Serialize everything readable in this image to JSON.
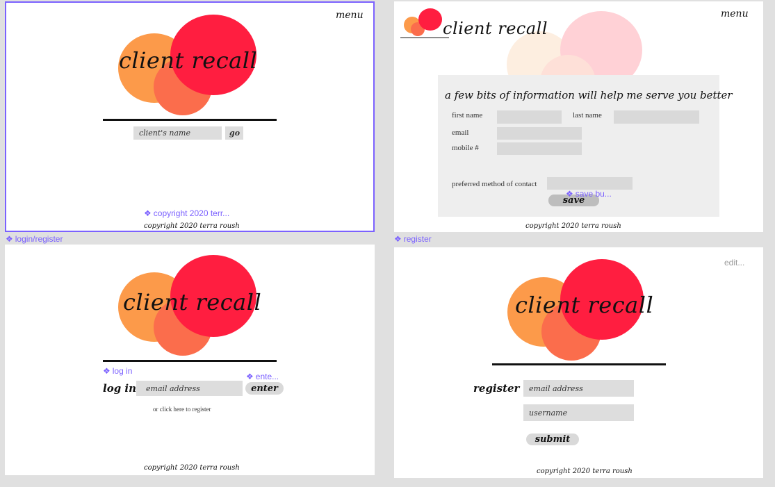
{
  "frames": {
    "home": {
      "menu": "menu",
      "logo": "client recall",
      "search_placeholder": "client's name",
      "go": "go",
      "component_label": "copyright 2020 terr...",
      "copyright": "copyright 2020 terra roush",
      "frame_label": "login/register"
    },
    "info": {
      "menu": "menu",
      "logo": "client recall",
      "heading": "a few bits of information will help me serve you better",
      "first_name": "first name",
      "last_name": "last name",
      "email": "email",
      "mobile": "mobile #",
      "preferred": "preferred method of contact",
      "save": "save",
      "component_label": "save bu...",
      "copyright": "copyright 2020 terra roush",
      "frame_label": "register"
    },
    "login": {
      "logo": "client recall",
      "component_label": "log in",
      "enter_component_label": "ente...",
      "log_in": "log in",
      "email_placeholder": "email address",
      "enter": "enter",
      "register_link": "or click here to register",
      "copyright": "copyright 2020 terra roush"
    },
    "register": {
      "edit": "edit...",
      "logo": "client recall",
      "register": "register",
      "email_placeholder": "email address",
      "username_placeholder": "username",
      "submit": "submit",
      "copyright": "copyright 2020 terra roush"
    }
  },
  "colors": {
    "orange": "#fc9a4a",
    "coral": "#fb6d4c",
    "red": "#ff1e40",
    "figma_purple": "#7b61ff",
    "field_gray": "#dddddd"
  }
}
